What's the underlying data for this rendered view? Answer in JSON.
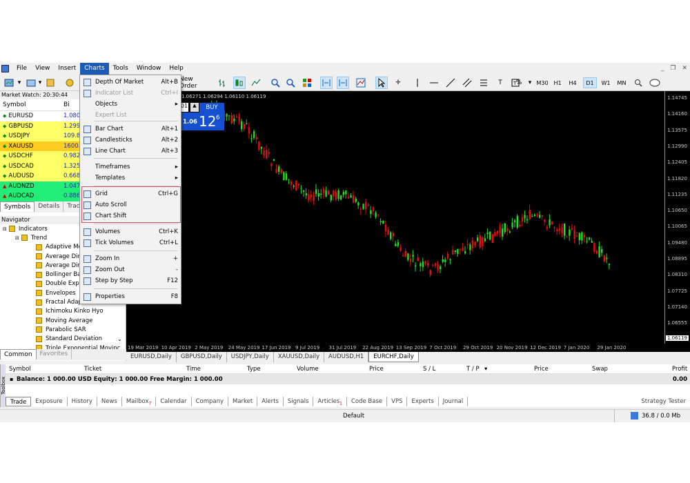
{
  "menubar": {
    "items": [
      "File",
      "View",
      "Insert",
      "Charts",
      "Tools",
      "Window",
      "Help"
    ]
  },
  "toolbar": {
    "new_order": "New Order",
    "timeframes": [
      "M30",
      "H1",
      "H4",
      "D1",
      "W1",
      "MN"
    ],
    "percent": "%"
  },
  "market_watch": {
    "title": "Market Watch: 20:30:44",
    "col_symbol": "Symbol",
    "col_bid": "Bi",
    "rows": [
      {
        "symbol": "EURUSD",
        "bid": "1.080",
        "dir": "up",
        "color": "#ffffff"
      },
      {
        "symbol": "GBPUSD",
        "bid": "1.299",
        "dir": "up",
        "color": "#ffff66"
      },
      {
        "symbol": "USDJPY",
        "bid": "109.8",
        "dir": "up",
        "color": "#ffff66"
      },
      {
        "symbol": "XAUUSD",
        "bid": "1600.",
        "dir": "up",
        "color": "#ffcc22"
      },
      {
        "symbol": "USDCHF",
        "bid": "0.982",
        "dir": "up",
        "color": "#ffff66"
      },
      {
        "symbol": "USDCAD",
        "bid": "1.325",
        "dir": "up",
        "color": "#ffff66"
      },
      {
        "symbol": "AUDUSD",
        "bid": "0.668",
        "dir": "up",
        "color": "#ffff66"
      },
      {
        "symbol": "AUDNZD",
        "bid": "1.047",
        "dir": "down",
        "color": "#22ee77"
      },
      {
        "symbol": "AUDCAD",
        "bid": "0.886",
        "dir": "down",
        "color": "#22ee77"
      }
    ],
    "tabs": [
      "Symbols",
      "Details",
      "Trad"
    ]
  },
  "navigator": {
    "title": "Navigator",
    "indicators": "Indicators",
    "trend": "Trend",
    "items": [
      "Adaptive Mo",
      "Average Dire",
      "Average Dire",
      "Bollinger Bar",
      "Double Expo",
      "Envelopes",
      "Fractal Adap",
      "Ichimoku Kinko Hyo",
      "Moving Average",
      "Parabolic SAR",
      "Standard Deviation",
      "Triple Exponential Movinc"
    ],
    "tabs": [
      "Common",
      "Favorites"
    ]
  },
  "chart": {
    "info": "1.06271 1.06294 1.06110 1.06119",
    "bid_prefix": "1.06",
    "bid_big": "12",
    "bid_sup": "6",
    "buy_label": "BUY",
    "spin_val": "01",
    "yticks": [
      "1.14745",
      "1.14160",
      "1.13575",
      "1.12990",
      "1.12405",
      "1.11820",
      "1.11235",
      "1.10650",
      "1.10065",
      "1.09480",
      "1.08895",
      "1.08310",
      "1.07725",
      "1.07140",
      "1.06555",
      "1.06119"
    ],
    "current_price": "1.06119",
    "xticks": [
      "19 Mar 2019",
      "10 Apr 2019",
      "2 May 2019",
      "24 May 2019",
      "17 Jun 2019",
      "9 Jul 2019",
      "31 Jul 2019",
      "22 Aug 2019",
      "13 Sep 2019",
      "7 Oct 2019",
      "29 Oct 2019",
      "20 Nov 2019",
      "12 Dec 2019",
      "7 Jan 2020",
      "29 Jan 2020"
    ],
    "tabs": [
      "EURUSD,Daily",
      "GBPUSD,Daily",
      "USDJPY,Daily",
      "XAUUSD,Daily",
      "AUDUSD,H1",
      "EURCHF,Daily"
    ]
  },
  "charts_menu": {
    "items": [
      {
        "label": "Depth Of Market",
        "shortcut": "Alt+B",
        "disabled": false
      },
      {
        "label": "Indicator List",
        "shortcut": "Ctrl+I",
        "disabled": true
      },
      {
        "label": "Objects",
        "shortcut": "▸",
        "disabled": false
      },
      {
        "label": "Expert List",
        "shortcut": "",
        "disabled": true
      },
      {
        "label": "Bar Chart",
        "shortcut": "Alt+1",
        "disabled": false
      },
      {
        "label": "Candlesticks",
        "shortcut": "Alt+2",
        "disabled": false
      },
      {
        "label": "Line Chart",
        "shortcut": "Alt+3",
        "disabled": false
      },
      {
        "label": "Timeframes",
        "shortcut": "▸",
        "disabled": false
      },
      {
        "label": "Templates",
        "shortcut": "▸",
        "disabled": false
      },
      {
        "label": "Grid",
        "shortcut": "Ctrl+G",
        "disabled": false
      },
      {
        "label": "Auto Scroll",
        "shortcut": "",
        "disabled": false
      },
      {
        "label": "Chart Shift",
        "shortcut": "",
        "disabled": false
      },
      {
        "label": "Volumes",
        "shortcut": "Ctrl+K",
        "disabled": false
      },
      {
        "label": "Tick Volumes",
        "shortcut": "Ctrl+L",
        "disabled": false
      },
      {
        "label": "Zoom In",
        "shortcut": "+",
        "disabled": false
      },
      {
        "label": "Zoom Out",
        "shortcut": "-",
        "disabled": false
      },
      {
        "label": "Step by Step",
        "shortcut": "F12",
        "disabled": false
      },
      {
        "label": "Properties",
        "shortcut": "F8",
        "disabled": false
      }
    ]
  },
  "terminal": {
    "cols": [
      "Symbol",
      "Ticket",
      "Time",
      "Type",
      "Volume",
      "Price",
      "S / L",
      "T / P",
      "Price",
      "Swap",
      "Profit"
    ],
    "balance": "Balance: 1 000.00 USD  Equity: 1 000.00  Free Margin: 1 000.00",
    "profit": "0.00",
    "tabs": [
      "Trade",
      "Exposure",
      "History",
      "News",
      "Mailbox",
      "Calendar",
      "Company",
      "Market",
      "Alerts",
      "Signals",
      "Articles",
      "Code Base",
      "VPS",
      "Experts",
      "Journal"
    ],
    "mailbox_badge": "7",
    "articles_badge": "1",
    "strategy": "Strategy Tester",
    "toolbox": "Toolbox"
  },
  "status": {
    "profile": "Default",
    "traffic": "36.8 / 0.0 Mb"
  }
}
